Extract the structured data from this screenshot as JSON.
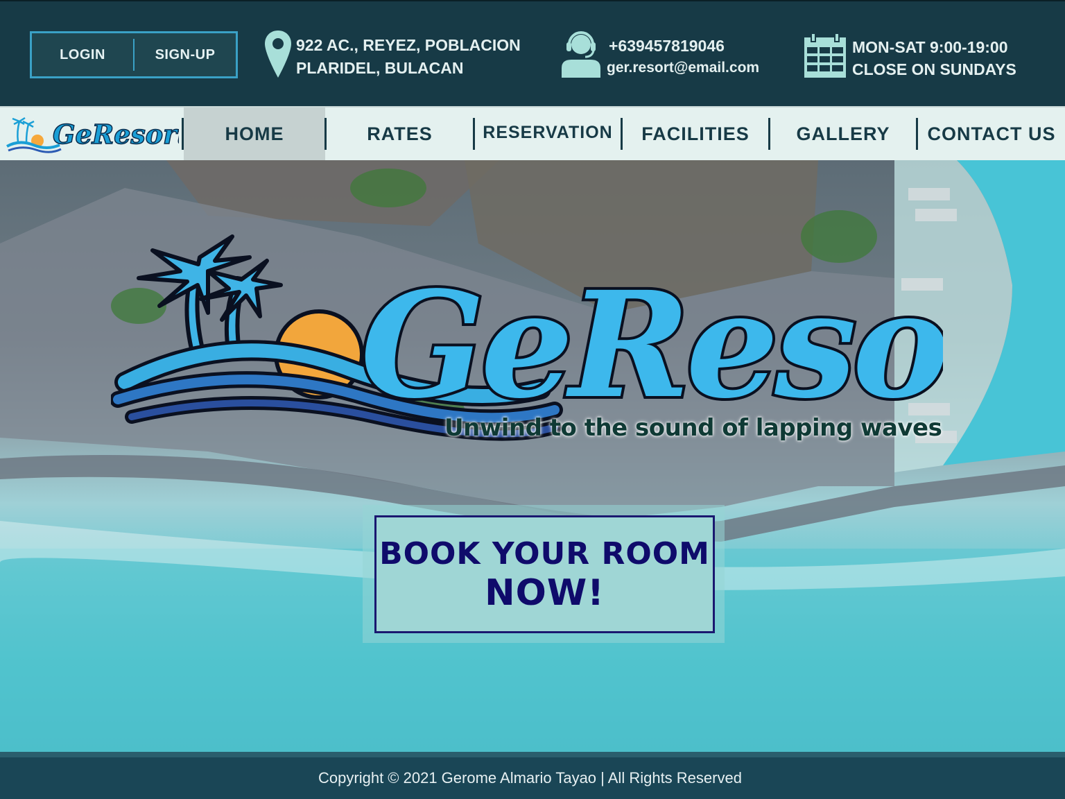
{
  "auth": {
    "login_label": "LOGIN",
    "signup_label": "SIGN-UP"
  },
  "contact": {
    "address_line1": "922 AC., REYEZ, POBLACION",
    "address_line2": "PLARIDEL, BULACAN",
    "phone": "+639457819046",
    "email": "ger.resort@email.com",
    "hours_line1": "MON-SAT 9:00-19:00",
    "hours_line2": "CLOSE ON SUNDAYS"
  },
  "nav": {
    "logo_text": "GeResort",
    "items": [
      {
        "label": "HOME",
        "active": true
      },
      {
        "label": "RATES"
      },
      {
        "label": "RESERVATION"
      },
      {
        "label": "FACILITIES"
      },
      {
        "label": "GALLERY"
      },
      {
        "label": "CONTACT US"
      }
    ]
  },
  "hero": {
    "logo_text": "GeResort",
    "tagline": "Unwind to the sound of lapping waves",
    "cta_line1": "BOOK YOUR ROOM",
    "cta_line2": "NOW!"
  },
  "footer": {
    "copyright": "Copyright © 2021 Gerome Almario Tayao | All Rights Reserved"
  },
  "colors": {
    "header_bg": "#173a46",
    "nav_bg": "#e4f1ef",
    "nav_active": "#c6d2d1",
    "accent_blue": "#3aa1c6",
    "cta_text": "#0f0b6b",
    "footer_bg": "#1a4656"
  },
  "icons": [
    "map-pin-icon",
    "headset-icon",
    "calendar-icon",
    "palm-tree-icon",
    "sun-icon",
    "wave-icon"
  ]
}
